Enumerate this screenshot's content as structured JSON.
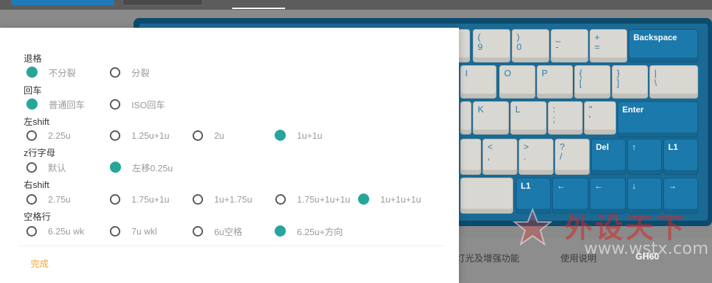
{
  "keyboard": {
    "rows": [
      [
        {
          "top": "(",
          "bottom": "9"
        },
        {
          "top": ")",
          "bottom": "0"
        },
        {
          "top": "_",
          "bottom": "-"
        },
        {
          "top": "+",
          "bottom": "="
        },
        {
          "label": "Backspace"
        }
      ],
      [
        {
          "label": "I"
        },
        {
          "label": "O"
        },
        {
          "label": "P"
        },
        {
          "top": "{",
          "bottom": "["
        },
        {
          "top": "}",
          "bottom": "]"
        },
        {
          "top": "|",
          "bottom": "\\"
        }
      ],
      [
        {
          "label": "K"
        },
        {
          "label": "L"
        },
        {
          "top": ":",
          "bottom": ";"
        },
        {
          "top": "\"",
          "bottom": "'"
        },
        {
          "label": "Enter"
        }
      ],
      [
        {
          "top": "<",
          "bottom": ","
        },
        {
          "top": ">",
          "bottom": "."
        },
        {
          "top": "?",
          "bottom": "/"
        },
        {
          "label": "Del"
        },
        {
          "label": "↑"
        },
        {
          "label": "L1"
        }
      ],
      [
        {
          "label": "L1"
        },
        {
          "label": "←"
        },
        {
          "label": "←"
        },
        {
          "label": "↓"
        },
        {
          "label": "→"
        }
      ]
    ]
  },
  "bottom_links": {
    "lighting": "灯光及增强功能",
    "manual": "使用说明",
    "product": "GH60"
  },
  "watermark": {
    "cn": "外设天下",
    "url": "www.wstx.com"
  },
  "modal": {
    "sections": [
      {
        "label": "退格",
        "options": [
          {
            "label": "不分裂",
            "selected": true
          },
          {
            "label": "分裂",
            "selected": false
          }
        ]
      },
      {
        "label": "回车",
        "options": [
          {
            "label": "普通回车",
            "selected": true
          },
          {
            "label": "ISO回车",
            "selected": false
          }
        ]
      },
      {
        "label": "左shift",
        "options": [
          {
            "label": "2.25u",
            "selected": false
          },
          {
            "label": "1.25u+1u",
            "selected": false
          },
          {
            "label": "2u",
            "selected": false
          },
          {
            "label": "1u+1u",
            "selected": true
          }
        ]
      },
      {
        "label": "z行字母",
        "options": [
          {
            "label": "默认",
            "selected": false
          },
          {
            "label": "左移0.25u",
            "selected": true
          }
        ]
      },
      {
        "label": "右shift",
        "options": [
          {
            "label": "2.75u",
            "selected": false
          },
          {
            "label": "1.75u+1u",
            "selected": false
          },
          {
            "label": "1u+1.75u",
            "selected": false
          },
          {
            "label": "1.75u+1u+1u",
            "selected": false
          },
          {
            "label": "1u+1u+1u",
            "selected": true
          }
        ]
      },
      {
        "label": "空格行",
        "options": [
          {
            "label": "6.25u wk",
            "selected": false
          },
          {
            "label": "7u wkl",
            "selected": false
          },
          {
            "label": "6u空格",
            "selected": false
          },
          {
            "label": "6.25u+方向",
            "selected": true
          }
        ]
      }
    ],
    "done_label": "完成"
  },
  "colors": {
    "accent_teal": "#26a69a",
    "done_orange": "#f5a623",
    "keycap_blue": "#1c79ab",
    "keycap_light": "#d9d7d2"
  }
}
